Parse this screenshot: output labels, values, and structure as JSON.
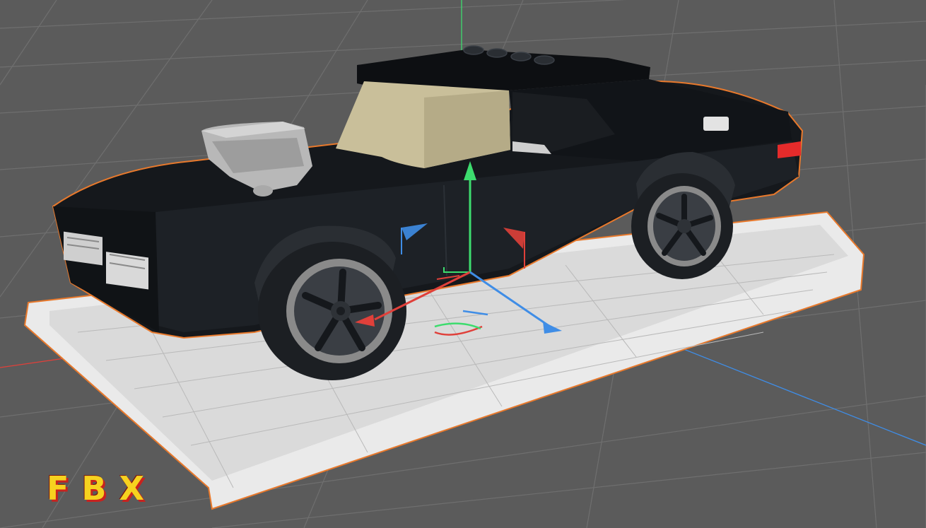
{
  "viewport": {
    "background_color": "#5b5b5b",
    "grid_color": "#6d6d6d",
    "selection_outline_color": "#e8792c",
    "axes": {
      "x_color": "#e0403a",
      "y_color": "#3ddc6e",
      "z_color": "#3f8de6"
    },
    "object": {
      "body_color": "#15181c",
      "canopy_color": "#c9bf9a",
      "engine_color": "#b8b8b8",
      "base_plate_color": "#e9e9e9",
      "taillight_color": "#e52b2b"
    },
    "icons": [
      "move-gizmo-icon",
      "rotate-gizmo-icon"
    ]
  },
  "format_badge": {
    "label": "FBX",
    "color": "#f6d21f",
    "shadow_color": "#c8231e"
  }
}
